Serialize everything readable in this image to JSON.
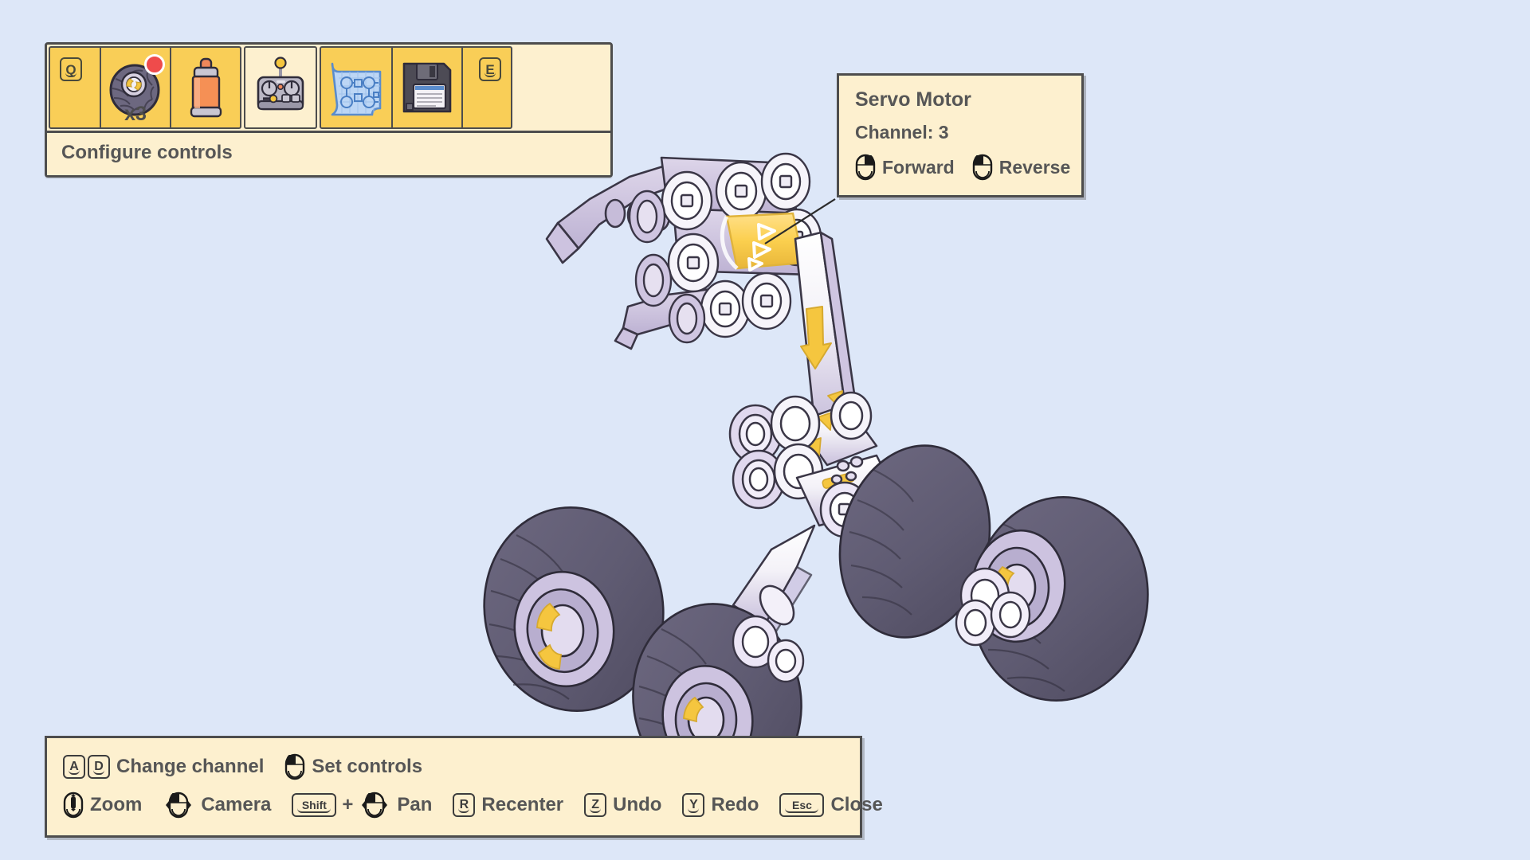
{
  "app": {
    "background_color": "#dde7f8",
    "panel_color": "#fdf0cf",
    "accent_color": "#f9ce57",
    "outline_color": "#4d4d4d",
    "text_color": "#565656",
    "highlight_color": "#fbcf4e",
    "badge_color": "#ef4b4b"
  },
  "toolbar": {
    "left_key": "Q",
    "right_key": "E",
    "label": "Configure controls",
    "slots": [
      {
        "icon": "wheel-icon",
        "count": "x3",
        "badge": true,
        "selected": false
      },
      {
        "icon": "spray-can-icon",
        "count": "",
        "badge": false,
        "selected": false
      },
      {
        "icon": "remote-control-icon",
        "count": "",
        "badge": false,
        "selected": true
      },
      {
        "icon": "blueprint-icon",
        "count": "",
        "badge": false,
        "selected": false
      },
      {
        "icon": "floppy-disk-icon",
        "count": "",
        "badge": false,
        "selected": false
      }
    ]
  },
  "info_panel": {
    "title": "Servo Motor",
    "channel": "Channel: 3",
    "actions": [
      {
        "icon": "mouse-right-button-icon",
        "label": "Forward"
      },
      {
        "icon": "mouse-left-button-icon",
        "label": "Reverse"
      }
    ]
  },
  "hints": {
    "row1": [
      {
        "keys": [
          "A",
          "D"
        ],
        "icon": "",
        "label": "Change channel"
      },
      {
        "keys": [],
        "icon": "mouse-icon",
        "label": "Set controls"
      }
    ],
    "row2": [
      {
        "keys": [],
        "icon": "mouse-scroll-icon",
        "label": "Zoom"
      },
      {
        "keys": [],
        "icon": "mouse-drag-left-icon",
        "label": "Camera"
      },
      {
        "keys": [
          "Shift"
        ],
        "icon": "mouse-drag-left-icon",
        "joiner": "+",
        "label": "Pan"
      },
      {
        "keys": [
          "R"
        ],
        "icon": "",
        "label": "Recenter"
      },
      {
        "keys": [
          "Z"
        ],
        "icon": "",
        "label": "Undo"
      },
      {
        "keys": [
          "Y"
        ],
        "icon": "",
        "label": "Redo"
      },
      {
        "keys": [
          "Esc"
        ],
        "icon": "",
        "label": "Close"
      }
    ]
  },
  "model": {
    "name": "robot-vehicle-assembly",
    "highlighted_part": "servo-motor",
    "description": "Isometric toy-brick rover with gripper arm, four knobby tires, and a highlighted yellow servo motor"
  }
}
